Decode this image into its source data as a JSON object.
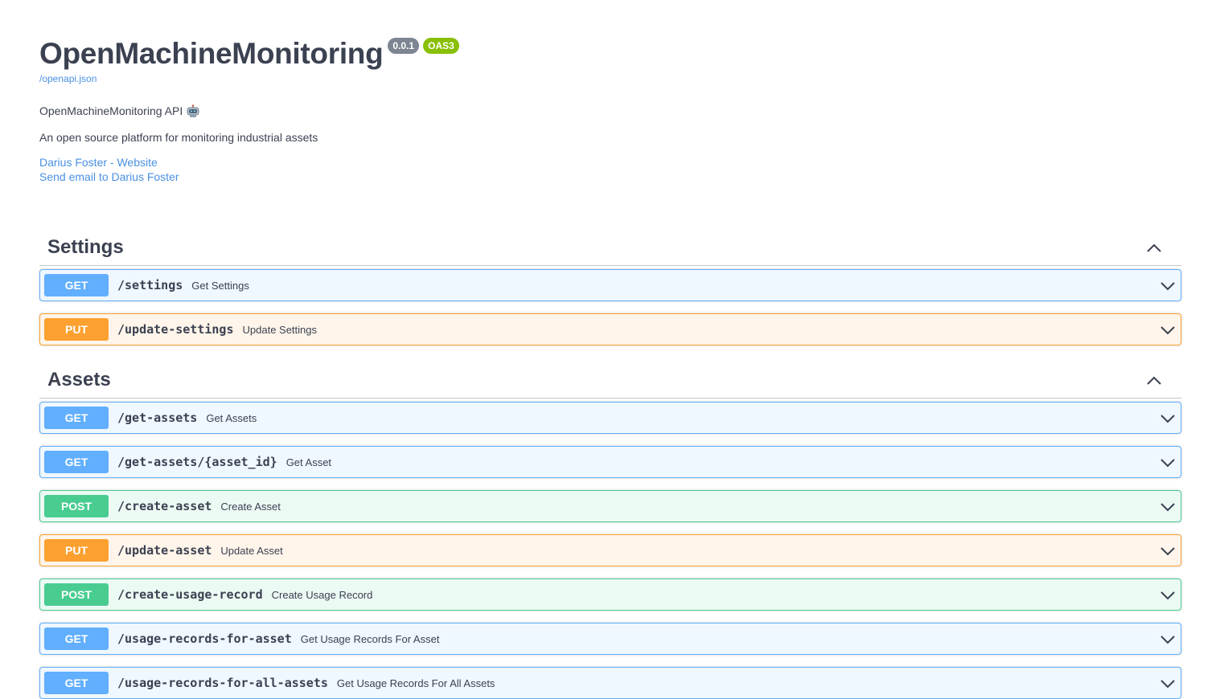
{
  "info": {
    "title": "OpenMachineMonitoring",
    "version_badge": "0.0.1",
    "oas_badge": "OAS3",
    "spec_link": "/openapi.json",
    "description_line": "OpenMachineMonitoring API",
    "description_icon": "robot-icon",
    "summary": "An open source platform for monitoring industrial assets",
    "contact_website": "Darius Foster - Website",
    "contact_email": "Send email to Darius Foster"
  },
  "colors": {
    "get": "#61affe",
    "put": "#fca130",
    "post": "#49cc90",
    "link": "#4990e2",
    "version_badge": "#7d8492",
    "oas_badge": "#89bf04"
  },
  "sections": [
    {
      "title": "Settings",
      "toggle_icon": "chevron-up-icon",
      "operations": [
        {
          "method": "GET",
          "path": "/settings",
          "summary": "Get Settings"
        },
        {
          "method": "PUT",
          "path": "/update-settings",
          "summary": "Update Settings"
        }
      ]
    },
    {
      "title": "Assets",
      "toggle_icon": "chevron-up-icon",
      "operations": [
        {
          "method": "GET",
          "path": "/get-assets",
          "summary": "Get Assets"
        },
        {
          "method": "GET",
          "path": "/get-assets/{asset_id}",
          "summary": "Get Asset"
        },
        {
          "method": "POST",
          "path": "/create-asset",
          "summary": "Create Asset"
        },
        {
          "method": "PUT",
          "path": "/update-asset",
          "summary": "Update Asset"
        },
        {
          "method": "POST",
          "path": "/create-usage-record",
          "summary": "Create Usage Record"
        },
        {
          "method": "GET",
          "path": "/usage-records-for-asset",
          "summary": "Get Usage Records For Asset"
        },
        {
          "method": "GET",
          "path": "/usage-records-for-all-assets",
          "summary": "Get Usage Records For All Assets"
        }
      ]
    }
  ]
}
